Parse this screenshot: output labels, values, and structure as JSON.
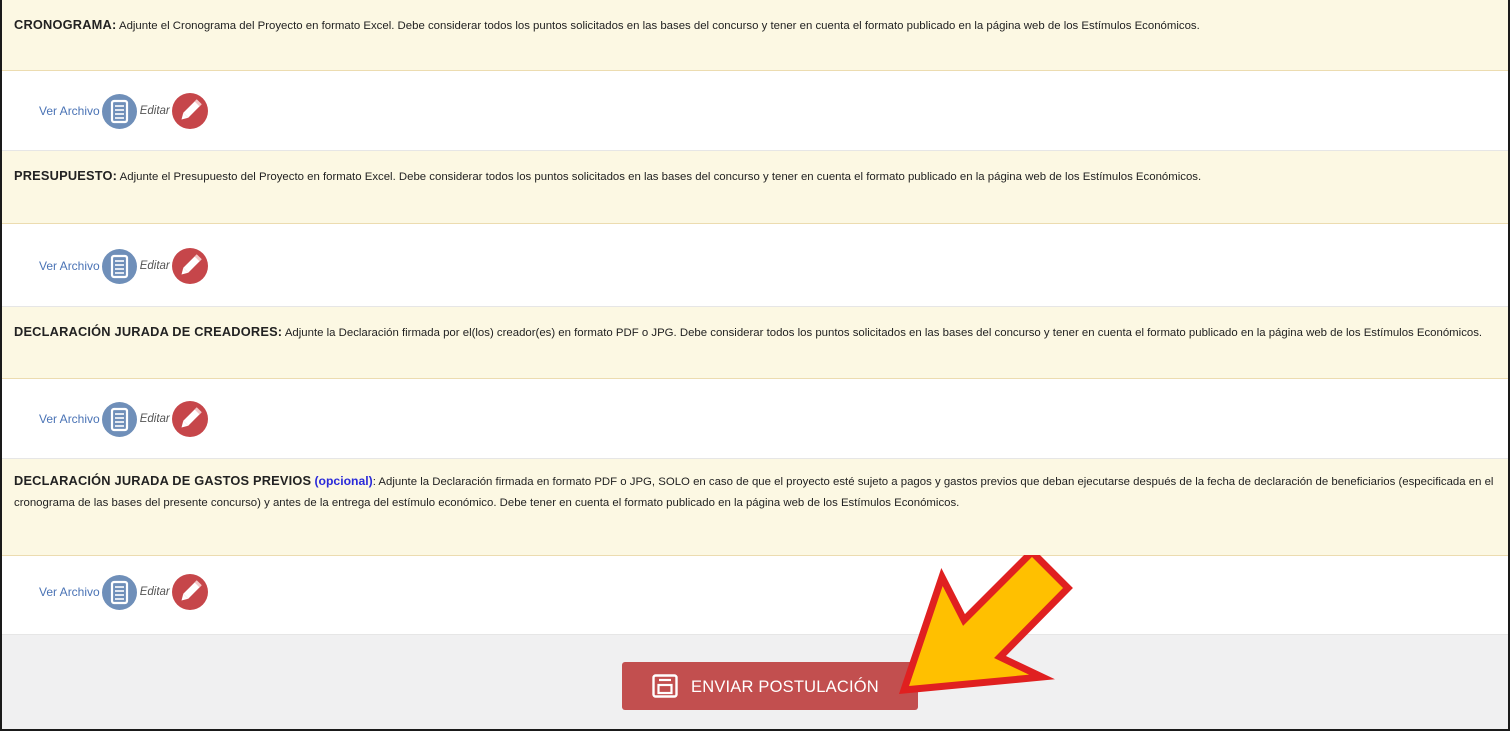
{
  "sections": [
    {
      "title": "CRONOGRAMA:",
      "text": " Adjunte el Cronograma del Proyecto en formato Excel. Debe considerar todos los puntos solicitados en las bases del concurso y tener en cuenta el formato publicado en la página web de los Estímulos Económicos."
    },
    {
      "title": "PRESUPUESTO:",
      "text": " Adjunte el Presupuesto del Proyecto en formato Excel. Debe considerar todos los puntos solicitados en las bases del concurso y tener en cuenta el formato publicado en la página web de los Estímulos Económicos."
    },
    {
      "title": "DECLARACIÓN JURADA DE CREADORES:",
      "text": " Adjunte la Declaración firmada por el(los) creador(es) en formato PDF o JPG. Debe considerar todos los puntos solicitados en las bases del concurso y tener en cuenta el formato publicado en la página web de los Estímulos Económicos."
    },
    {
      "title": "DECLARACIÓN JURADA DE GASTOS PREVIOS",
      "optional": "(opcional)",
      "text": ": Adjunte la Declaración firmada en formato PDF o JPG, SOLO en caso de que el proyecto esté sujeto a pagos y gastos previos que deban ejecutarse después de la fecha de declaración de beneficiarios (especificada en el cronograma de las bases del presente concurso) y antes de la entrega del estímulo económico. Debe tener en cuenta el formato publicado en la página web de los Estímulos Económicos."
    }
  ],
  "actions": {
    "view_label": "Ver Archivo",
    "edit_label": "Editar"
  },
  "footer": {
    "submit_label": "ENVIAR POSTULACIÓN"
  },
  "colors": {
    "description_bg": "#fcf8e3",
    "view_icon": "#6f8fb9",
    "edit_icon": "#c6464a",
    "submit_button": "#c24f4f",
    "arrow_fill": "#ffc000",
    "arrow_stroke": "#e02020"
  },
  "icons": {
    "view": "document-icon",
    "edit": "pencil-icon",
    "submit": "save-icon",
    "callout": "arrow-icon"
  }
}
